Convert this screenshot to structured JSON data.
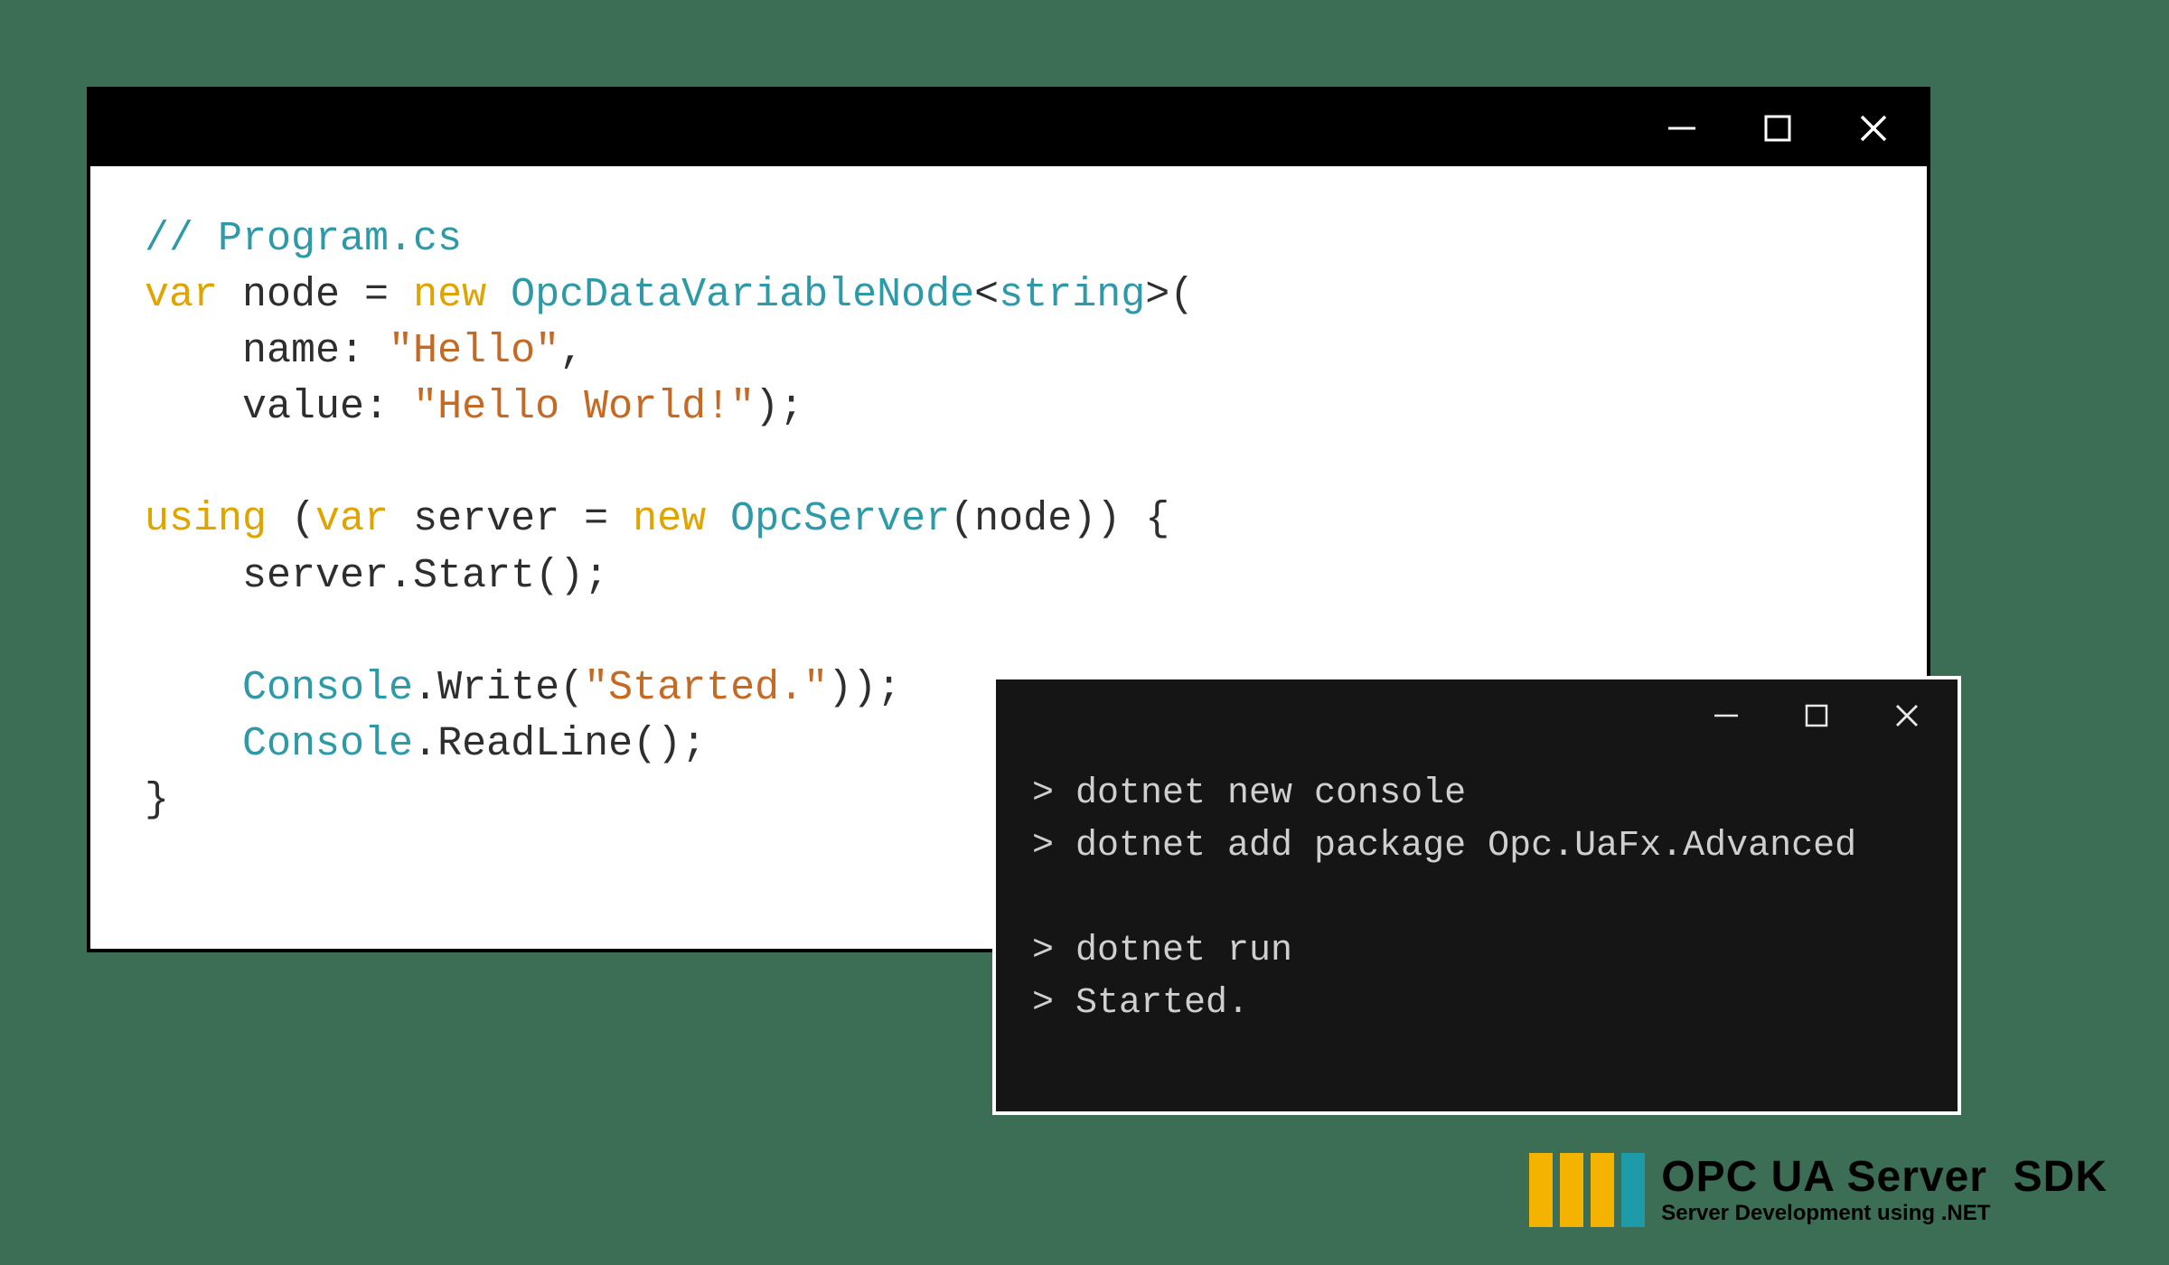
{
  "code": {
    "l1_comment": "// Program.cs",
    "l2_var": "var",
    "l2_node": " node = ",
    "l2_new": "new",
    "l2_type": " OpcDataVariableNode",
    "l2_lt": "<",
    "l2_string_t": "string",
    "l2_gt": ">(",
    "l3_indent": "    name: ",
    "l3_str": "\"Hello\"",
    "l3_comma": ",",
    "l4_indent": "    value: ",
    "l4_str": "\"Hello World!\"",
    "l4_close": ");",
    "l6_using": "using",
    "l6_open": " (",
    "l6_var": "var",
    "l6_server": " server = ",
    "l6_new": "new",
    "l6_type": " OpcServer",
    "l6_rest": "(node)) {",
    "l7": "    server.Start();",
    "l9a": "    ",
    "l9_console": "Console",
    "l9b": ".Write(",
    "l9_str": "\"Started.\"",
    "l9c": "));",
    "l10a": "    ",
    "l10_console": "Console",
    "l10b": ".ReadLine();",
    "l11": "}"
  },
  "terminal": {
    "l1": "> dotnet new console",
    "l2": "> dotnet add package Opc.UaFx.Advanced",
    "l3": "",
    "l4": "> dotnet run",
    "l5": "> Started."
  },
  "badge": {
    "title": "OPC UA Server  SDK",
    "subtitle": "Server Development using .NET"
  }
}
